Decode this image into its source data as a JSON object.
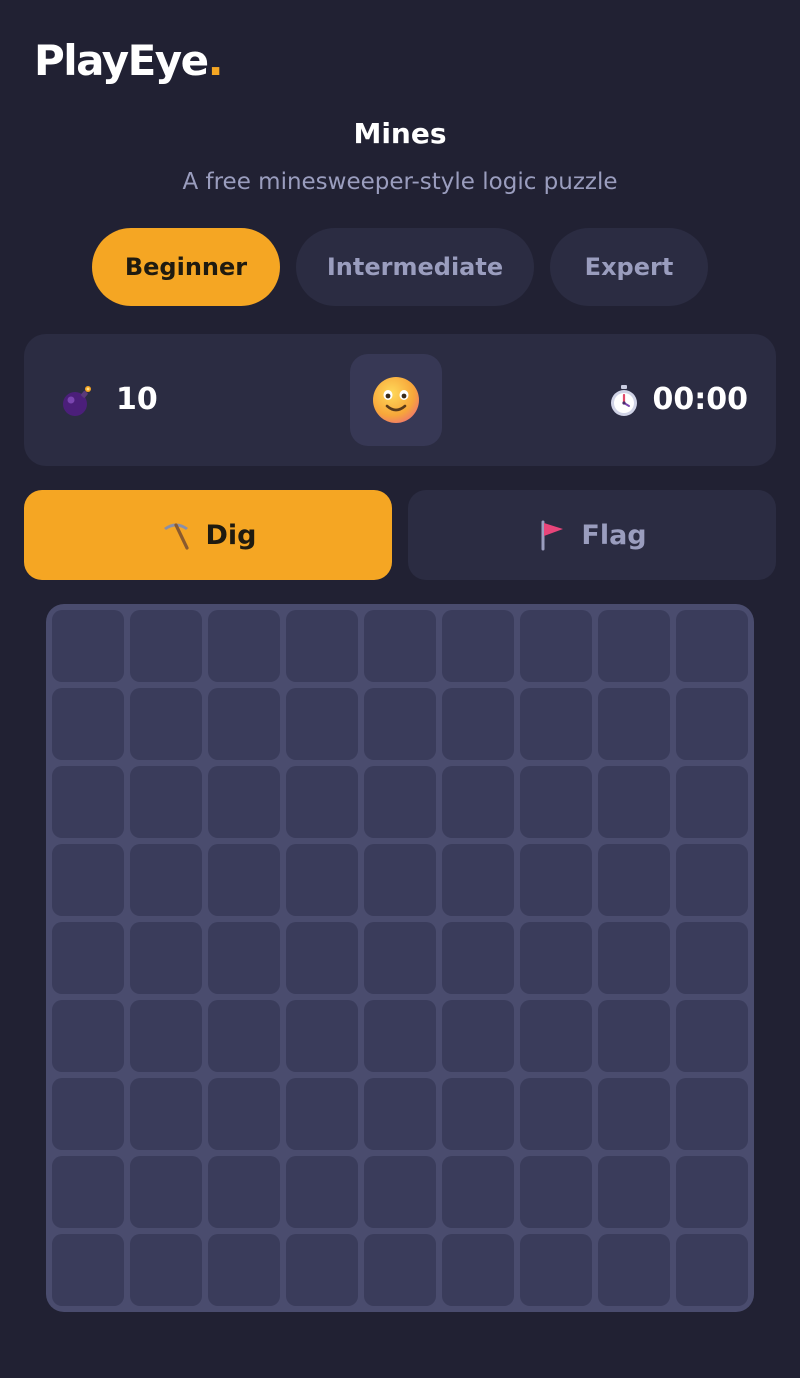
{
  "brand": {
    "name": "PlayEye",
    "dot": "."
  },
  "game": {
    "title": "Mines",
    "subtitle": "A free minesweeper-style logic puzzle"
  },
  "difficulty": {
    "options": [
      "Beginner",
      "Intermediate",
      "Expert"
    ],
    "selected": "Beginner"
  },
  "status": {
    "mine_count": "10",
    "timer": "00:00",
    "face_state": "smiling"
  },
  "modes": {
    "dig_label": "Dig",
    "flag_label": "Flag",
    "selected": "Dig"
  },
  "board": {
    "rows": 9,
    "cols": 9,
    "cells_state": "all-unrevealed"
  },
  "colors": {
    "background": "#212133",
    "accent": "#f5a623",
    "panel": "#2b2c42",
    "muted_text": "#9a9dbe",
    "board": "#4a4c6e",
    "cell": "#3a3c5b"
  }
}
